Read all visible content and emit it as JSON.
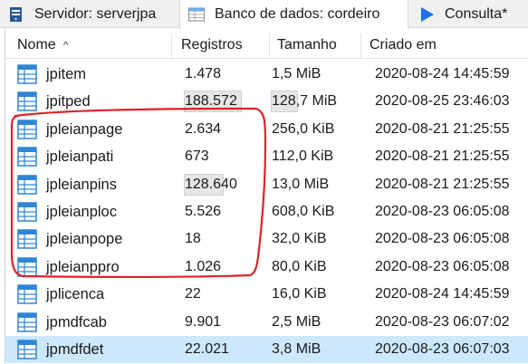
{
  "tabs": [
    {
      "label": "Servidor: serverjpa",
      "icon": "server-icon"
    },
    {
      "label": "Banco de dados: cordeiro",
      "icon": "database-icon"
    },
    {
      "label": "Consulta*",
      "icon": "play-icon"
    }
  ],
  "columns": {
    "name": "Nome",
    "records": "Registros",
    "size": "Tamanho",
    "created": "Criado em"
  },
  "rows": [
    {
      "name": "jpitem",
      "records": "1.478",
      "size": "1,5 MiB",
      "created": "2020-08-24 14:45:59",
      "records_fraction": 0,
      "size_fraction": 0
    },
    {
      "name": "jpitped",
      "records": "188.572",
      "size": "128,7 MiB",
      "created": "2020-08-25 23:46:03",
      "records_fraction": 1,
      "size_fraction": 1
    },
    {
      "name": "jpleianpage",
      "records": "2.634",
      "size": "256,0 KiB",
      "created": "2020-08-21 21:25:55"
    },
    {
      "name": "jpleianpati",
      "records": "673",
      "size": "112,0 KiB",
      "created": "2020-08-21 21:25:55"
    },
    {
      "name": "jpleianpins",
      "records": "128.640",
      "size": "13,0 MiB",
      "created": "2020-08-21 21:25:55",
      "records_fraction": 0.68
    },
    {
      "name": "jpleianploc",
      "records": "5.526",
      "size": "608,0 KiB",
      "created": "2020-08-23 06:05:08"
    },
    {
      "name": "jpleianpope",
      "records": "18",
      "size": "32,0 KiB",
      "created": "2020-08-23 06:05:08"
    },
    {
      "name": "jpleianppro",
      "records": "1.026",
      "size": "80,0 KiB",
      "created": "2020-08-23 06:05:08"
    },
    {
      "name": "jplicenca",
      "records": "22",
      "size": "16,0 KiB",
      "created": "2020-08-24 14:45:59"
    },
    {
      "name": "jpmdfcab",
      "records": "9.901",
      "size": "2,5 MiB",
      "created": "2020-08-23 06:07:02"
    },
    {
      "name": "jpmdfdet",
      "records": "22.021",
      "size": "3,8 MiB",
      "created": "2020-08-23 06:07:03",
      "selected": true
    }
  ],
  "colors": {
    "selection": "#cce8ff",
    "annotation": "#e0202a",
    "table_icon": "#2f86d6"
  },
  "icons": {
    "table": "table-icon",
    "sort": "sort-ascending-icon"
  },
  "sort_indicator": "^"
}
